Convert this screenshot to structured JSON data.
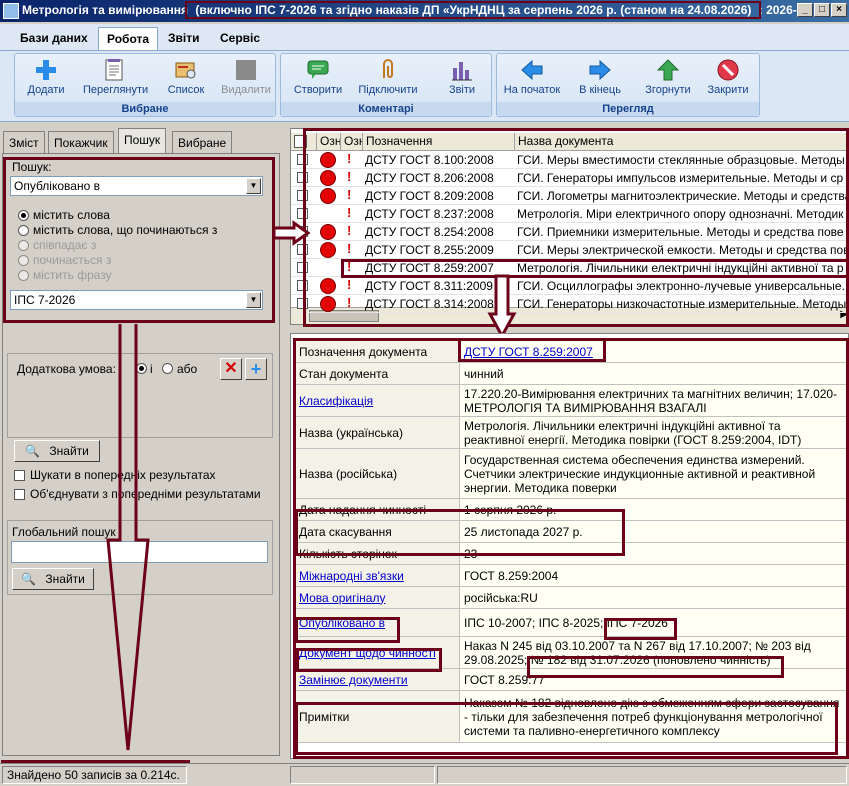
{
  "window": {
    "title_prefix": "Метрологія та вимірювання",
    "title_highlight": "(включно ІПС 7-2026 та згідно наказів ДП «УкрНДНЦ за серпень 2026 р. (станом на  24.08.2026)",
    "title_suffix": ": 2026-...",
    "min_glyph": "_",
    "max_glyph": "□",
    "close_glyph": "×"
  },
  "menu_tabs": [
    "Бази даних",
    "Робота",
    "Звіти",
    "Сервіс"
  ],
  "ribbon": {
    "groups": [
      {
        "label": "Вибране",
        "buttons": [
          {
            "label": "Додати",
            "icon": "plus-icon"
          },
          {
            "label": "Переглянути",
            "icon": "document-view-icon"
          },
          {
            "label": "Список",
            "icon": "list-icon"
          },
          {
            "label": "Видалити",
            "icon": "delete-icon",
            "disabled": true
          }
        ]
      },
      {
        "label": "Коментарі",
        "buttons": [
          {
            "label": "Створити",
            "icon": "comment-icon"
          },
          {
            "label": "Підключити",
            "icon": "paperclip-icon"
          },
          {
            "label": "Звіти",
            "icon": "bar-chart-icon"
          }
        ]
      },
      {
        "label": "Перегляд",
        "buttons": [
          {
            "label": "На початок",
            "icon": "arrow-left-icon"
          },
          {
            "label": "В кінець",
            "icon": "arrow-right-icon"
          },
          {
            "label": "Згорнути",
            "icon": "arrow-up-icon"
          },
          {
            "label": "Закрити",
            "icon": "close-circle-icon"
          }
        ]
      }
    ]
  },
  "left_tabs": [
    "Зміст",
    "Покажчик",
    "Пошук",
    "Вибране"
  ],
  "search": {
    "label": "Пошук:",
    "field_value": "Опубліковано в",
    "options": [
      "містить слова",
      "містить слова, що починаються з",
      "співпадає з",
      "починається з",
      "містить фразу"
    ],
    "value": "ІПС 7-2026",
    "extra_condition_label": "Додаткова умова:",
    "and_label": "і",
    "or_label": "або",
    "find_label": "Знайти",
    "search_in_previous": "Шукати в попередніх результатах",
    "merge_previous": "Об'єднувати з попередніми результатами",
    "global_label": "Глобальний пошук",
    "global_value": "",
    "global_find_label": "Знайти"
  },
  "list": {
    "columns": [
      "Озн",
      "Озн",
      "Позначення",
      "Назва документа"
    ],
    "rows": [
      {
        "designation": "ДСТУ ГОСТ 8.100:2008",
        "name": "ГСИ. Меры вместимости стеклянные образцовые. Методы",
        "dot": true
      },
      {
        "designation": "ДСТУ ГОСТ 8.206:2008",
        "name": "ГСИ. Генераторы импульсов измерительные. Методы и ср",
        "dot": true
      },
      {
        "designation": "ДСТУ ГОСТ 8.209:2008",
        "name": "ГСИ. Логометры магнитоэлектрические. Методы и средства",
        "dot": true
      },
      {
        "designation": "ДСТУ ГОСТ 8.237:2008",
        "name": "Метрологія. Міри електричного опору однозначні. Методик",
        "dot": false
      },
      {
        "designation": "ДСТУ ГОСТ 8.254:2008",
        "name": "ГСИ. Приемники измерительные. Методы и средства пове",
        "dot": true
      },
      {
        "designation": "ДСТУ ГОСТ 8.255:2009",
        "name": "ГСИ. Меры электрической емкости. Методы и средства пов",
        "dot": true
      },
      {
        "designation": "ДСТУ ГОСТ 8.259:2007",
        "name": "Метрологія. Лічильники електричні індукційні активної та р",
        "dot": false
      },
      {
        "designation": "ДСТУ ГОСТ 8.311:2009",
        "name": "ГСИ. Осциллографы электронно-лучевые универсальные.",
        "dot": true
      },
      {
        "designation": "ДСТУ ГОСТ 8.314:2008",
        "name": "ГСИ. Генераторы низкочастотные измерительные. Методы",
        "dot": true
      }
    ]
  },
  "details": [
    {
      "label": "Позначення документа",
      "value": "ДСТУ ГОСТ 8.259:2007",
      "value_link": true,
      "label_link": false
    },
    {
      "label": "Стан документа",
      "value": "чинний"
    },
    {
      "label": "Класифікація",
      "label_link": true,
      "value": "17.220.20-Вимірювання електричних та магнітних величин; 17.020-МЕТРОЛОГІЯ ТА ВИМІРЮВАННЯ ВЗАГАЛІ"
    },
    {
      "label": "Назва (українська)",
      "value": "Метрологія. Лічильники електричні індукційні активної та реактивної енергії. Методика повірки (ГОСТ 8.259:2004, IDT)"
    },
    {
      "label": "Назва (російська)",
      "value": "Государственная система обеспечения единства измерений. Счетчики электрические индукционные активной и реактивной энергии. Методика поверки"
    },
    {
      "label": "Дата надання чинності",
      "value": "1 серпня 2026 р."
    },
    {
      "label": "Дата скасування",
      "value": "25 листопада 2027 р."
    },
    {
      "label": "Кількість сторінок",
      "value": "23"
    },
    {
      "label": "Міжнародні зв'язки",
      "label_link": true,
      "value": "ГОСТ 8.259:2004"
    },
    {
      "label": "Мова оригіналу",
      "label_link": true,
      "value": "російська:RU"
    },
    {
      "label": "Опубліковано в",
      "label_link": true,
      "value": "ІПС 10-2007; ІПС 8-2025; ІПС 7-2026"
    },
    {
      "label": "Документ щодо чинності",
      "label_link": true,
      "value": "Наказ N 245 від 03.10.2007 та N 267 від 17.10.2007; № 203 від 29.08.2025; № 182 від 31.07.2026 (поновлено чинність)"
    },
    {
      "label": "Замінює документи",
      "label_link": true,
      "value": "ГОСТ 8.259:77"
    },
    {
      "label": "Примітки",
      "value": "Наказом № 182 відновлено дію з обмеженням сфери застосування - тільки для забезпечення потреб функціонування метрологічної системи та паливно-енергетичного комплексу"
    }
  ],
  "status": {
    "found": "Знайдено 50 записів за 0.214с."
  },
  "colors": {
    "accent_highlight": "#6b0018",
    "link": "#0000cc",
    "status_dot": "#e30000"
  }
}
